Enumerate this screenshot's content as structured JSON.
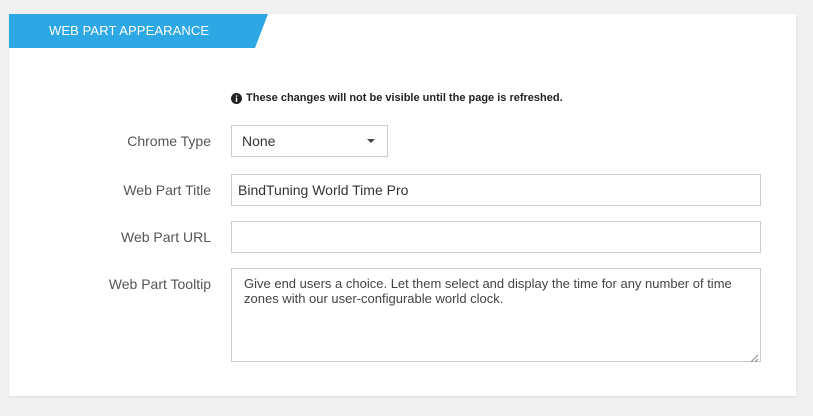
{
  "section": {
    "title": "WEB PART APPEARANCE"
  },
  "notice": {
    "icon": "info-circle-icon",
    "text": "These changes will not be visible until the page is refreshed."
  },
  "fields": {
    "chrome_type": {
      "label": "Chrome Type",
      "value": "None"
    },
    "title": {
      "label": "Web Part Title",
      "value": "BindTuning World Time Pro"
    },
    "url": {
      "label": "Web Part URL",
      "value": ""
    },
    "tooltip": {
      "label": "Web Part Tooltip",
      "value": "Give end users a choice. Let them select and display the time for any number of time zones with our user-configurable world clock."
    }
  },
  "colors": {
    "accent": "#2ea8e5",
    "background": "#f0f0f0",
    "panel": "#ffffff",
    "border": "#cccccc"
  }
}
